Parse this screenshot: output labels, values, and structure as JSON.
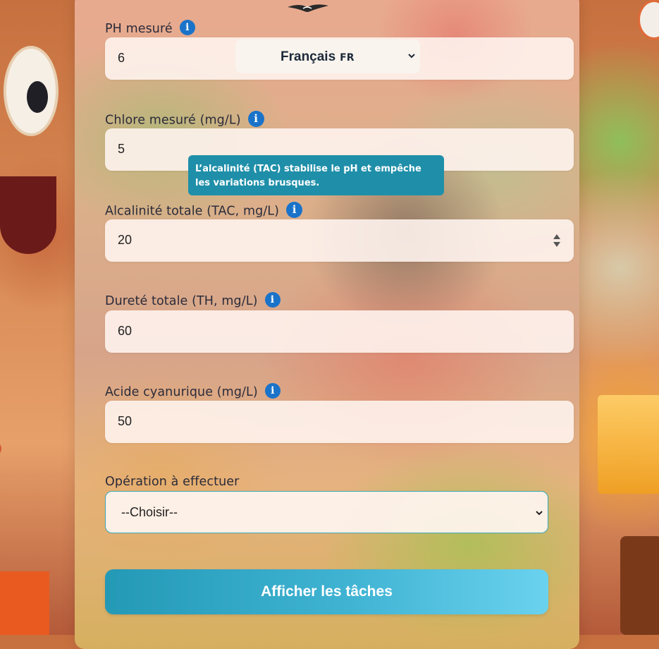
{
  "language": {
    "label": "Français",
    "code": "FR"
  },
  "fields": {
    "ph": {
      "label": "PH mesuré",
      "value": "6"
    },
    "chlore": {
      "label": "Chlore mesuré (mg/L)",
      "value": "5"
    },
    "tac": {
      "label": "Alcalinité totale (TAC, mg/L)",
      "value": "20"
    },
    "th": {
      "label": "Dureté totale (TH, mg/L)",
      "value": "60"
    },
    "cya": {
      "label": "Acide cyanurique (mg/L)",
      "value": "50"
    }
  },
  "tooltip": {
    "text": "L’alcalinité (TAC) stabilise le pH et empêche les variations brusques."
  },
  "operation": {
    "label": "Opération à effectuer",
    "selected": "--Choisir--"
  },
  "submit": {
    "label": "Afficher les tâches"
  },
  "info_icon_glyph": "i",
  "colors": {
    "accent": "#1a73c9",
    "tooltip": "#1f8fa9",
    "button": "#40b3d3"
  }
}
